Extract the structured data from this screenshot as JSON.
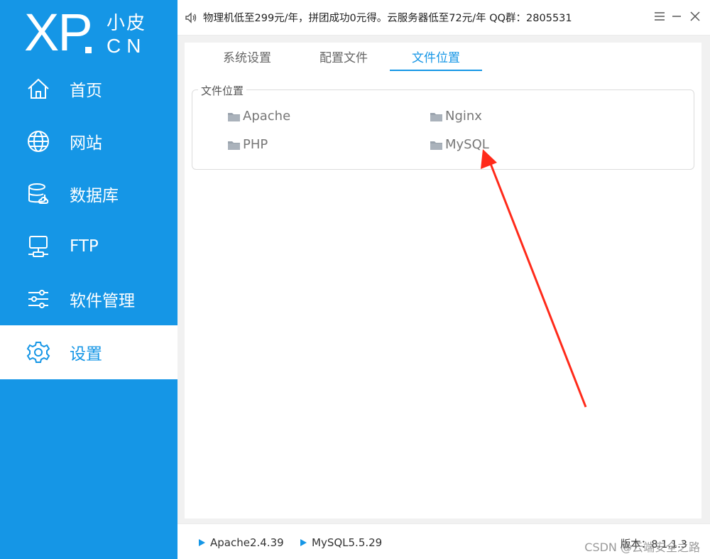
{
  "logo": {
    "main": "XP",
    "cn_top": "小皮",
    "cn_bottom": "CN"
  },
  "nav": [
    {
      "label": "首页",
      "icon": "home-icon"
    },
    {
      "label": "网站",
      "icon": "globe-icon"
    },
    {
      "label": "数据库",
      "icon": "database-icon"
    },
    {
      "label": "FTP",
      "icon": "ftp-icon"
    },
    {
      "label": "软件管理",
      "icon": "sliders-icon"
    },
    {
      "label": "设置",
      "icon": "gear-icon",
      "active": true
    }
  ],
  "header": {
    "announcement": "物理机低至299元/年，拼团成功0元得。云服务器低至72元/年 QQ群：2805531"
  },
  "tabs": [
    {
      "label": "系统设置"
    },
    {
      "label": "配置文件"
    },
    {
      "label": "文件位置",
      "active": true
    }
  ],
  "file_locations": {
    "legend": "文件位置",
    "links": [
      "Apache",
      "Nginx",
      "PHP",
      "MySQL"
    ]
  },
  "footer": {
    "services": [
      "Apache2.4.39",
      "MySQL5.5.29"
    ],
    "version": "版本：8.1.1.3",
    "watermark": "CSDN @云端安全之路"
  },
  "colors": {
    "brand": "#1596e6",
    "annotation": "#ff2a1a"
  }
}
